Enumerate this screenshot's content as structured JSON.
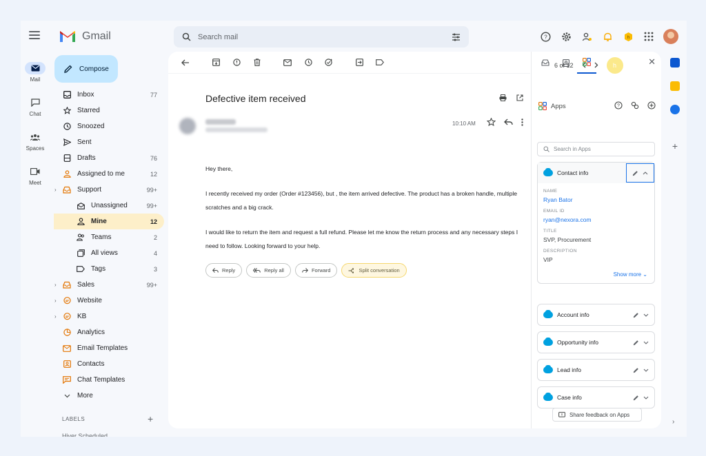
{
  "brand": {
    "app_name": "Gmail"
  },
  "search": {
    "placeholder": "Search mail"
  },
  "rail": [
    {
      "label": "Mail",
      "icon": "mail-icon",
      "active": true
    },
    {
      "label": "Chat",
      "icon": "chat-icon"
    },
    {
      "label": "Spaces",
      "icon": "spaces-icon"
    },
    {
      "label": "Meet",
      "icon": "meet-icon"
    }
  ],
  "compose": {
    "label": "Compose"
  },
  "nav": [
    {
      "label": "Inbox",
      "count": "77",
      "icon": "inbox-icon"
    },
    {
      "label": "Starred",
      "count": "",
      "icon": "star-icon"
    },
    {
      "label": "Snoozed",
      "count": "",
      "icon": "clock-icon"
    },
    {
      "label": "Sent",
      "count": "",
      "icon": "send-icon"
    },
    {
      "label": "Drafts",
      "count": "76",
      "icon": "draft-icon"
    },
    {
      "label": "Assigned to me",
      "count": "12",
      "icon": "person-icon"
    },
    {
      "label": "Support",
      "count": "99+",
      "icon": "inbox-tray-icon"
    },
    {
      "label": "Unassigned",
      "count": "99+",
      "icon": "envelope-icon"
    },
    {
      "label": "Mine",
      "count": "12",
      "icon": "person-icon"
    },
    {
      "label": "Teams",
      "count": "2",
      "icon": "people-icon"
    },
    {
      "label": "All views",
      "count": "4",
      "icon": "views-icon"
    },
    {
      "label": "Tags",
      "count": "3",
      "icon": "tag-icon"
    },
    {
      "label": "Sales",
      "count": "99+",
      "icon": "inbox-tray-icon"
    },
    {
      "label": "Website",
      "count": "",
      "icon": "chat-bubble-icon"
    },
    {
      "label": "KB",
      "count": "",
      "icon": "chat-bubble-icon"
    },
    {
      "label": "Analytics",
      "count": "",
      "icon": "pie-chart-icon"
    },
    {
      "label": "Email Templates",
      "count": "",
      "icon": "email-template-icon"
    },
    {
      "label": "Contacts",
      "count": "",
      "icon": "contact-card-icon"
    },
    {
      "label": "Chat Templates",
      "count": "",
      "icon": "chat-template-icon"
    },
    {
      "label": "More",
      "count": "",
      "icon": "chevron-down-icon"
    }
  ],
  "labels": {
    "heading": "LABELS",
    "cut_item": "Hiver Scheduled"
  },
  "pager": {
    "text": "6 of 12",
    "badge": "h"
  },
  "email": {
    "subject": "Defective item received",
    "time": "10:10 AM",
    "greeting": "Hey there,",
    "para1": "I recently received my order (Order #123456), but , the item arrived defective. The product has a broken handle, multiple scratches and a big crack.",
    "para2": "I would like to return the item and request a full refund. Please let me know the return process and any necessary steps I need to follow.  Looking forward to your help."
  },
  "actions": {
    "reply": "Reply",
    "reply_all": "Reply all",
    "forward": "Forward",
    "split": "Split conversation"
  },
  "panel": {
    "apps_title": "Apps",
    "search_placeholder": "Search in Apps",
    "contact": {
      "title": "Contact info",
      "name_label": "NAME",
      "name": "Ryan Bator",
      "email_label": "EMAIL ID",
      "email": "ryan@nexora.com",
      "title_label": "TITLE",
      "title_value": "SVP, Procurement",
      "desc_label": "DESCRIPTION",
      "desc": "VIP",
      "show_more": "Show more"
    },
    "cards": [
      "Account info",
      "Opportunity info",
      "Lead info",
      "Case info"
    ],
    "feedback": "Share feedback on Apps"
  },
  "colors": {
    "accent": "#0b57d0",
    "compose_bg": "#c2e7ff",
    "active_nav": "#fdefc9",
    "salesforce": "#00a1e0"
  }
}
